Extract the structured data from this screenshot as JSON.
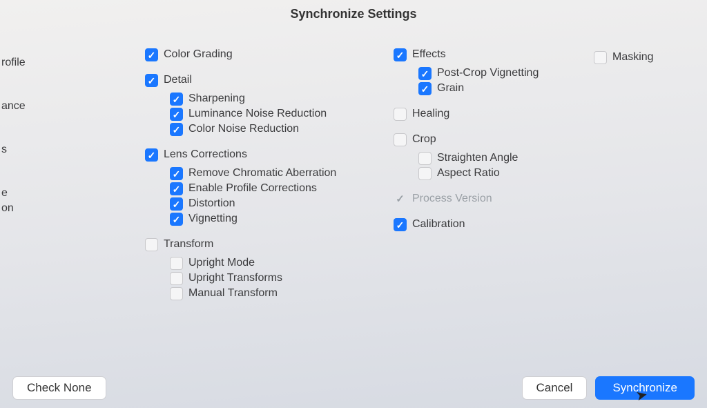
{
  "title": "Synchronize Settings",
  "leftFragments": [
    "rofile",
    "ance",
    "s",
    "e",
    "on"
  ],
  "colorGrading": {
    "label": "Color Grading"
  },
  "detail": {
    "label": "Detail",
    "sharpening": "Sharpening",
    "luminance": "Luminance Noise Reduction",
    "colorNoise": "Color Noise Reduction"
  },
  "lens": {
    "label": "Lens Corrections",
    "removeCA": "Remove Chromatic Aberration",
    "enableProfile": "Enable Profile Corrections",
    "distortion": "Distortion",
    "vignetting": "Vignetting"
  },
  "transform": {
    "label": "Transform",
    "upright": "Upright Mode",
    "uprightTransforms": "Upright Transforms",
    "manual": "Manual Transform"
  },
  "effects": {
    "label": "Effects",
    "postCrop": "Post-Crop Vignetting",
    "grain": "Grain"
  },
  "healing": "Healing",
  "crop": {
    "label": "Crop",
    "straighten": "Straighten Angle",
    "aspect": "Aspect Ratio"
  },
  "processVersion": "Process Version",
  "calibration": "Calibration",
  "masking": "Masking",
  "buttons": {
    "checkNone": "Check None",
    "cancel": "Cancel",
    "synchronize": "Synchronize"
  }
}
